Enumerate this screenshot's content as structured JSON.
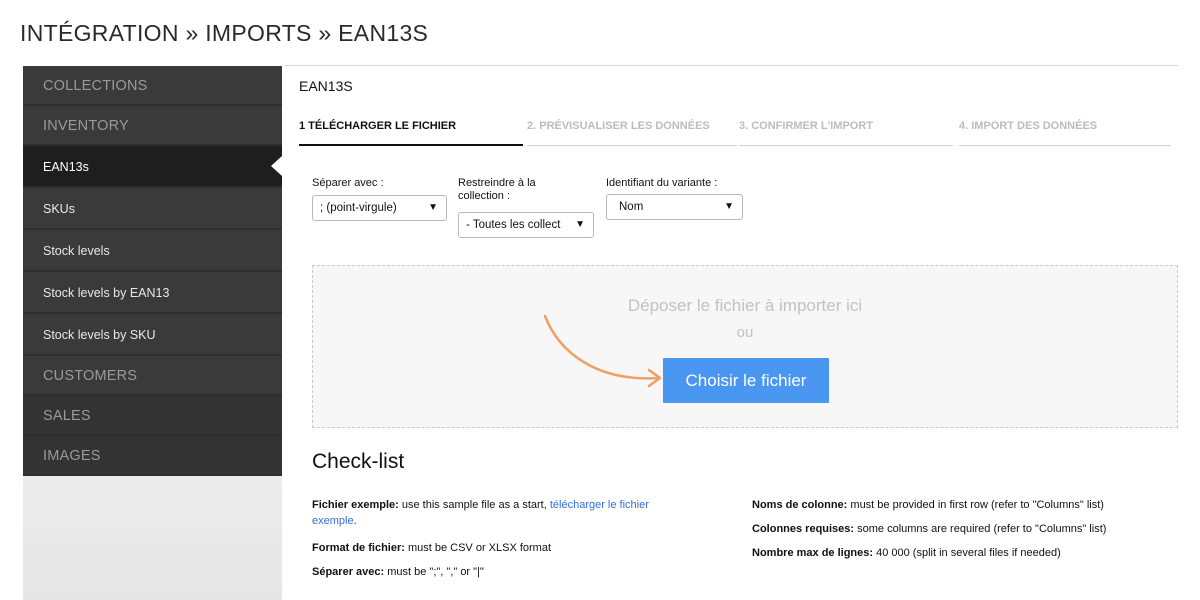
{
  "breadcrumb": "INTÉGRATION » IMPORTS » EAN13S",
  "sidebar": {
    "items": [
      {
        "label": "COLLECTIONS"
      },
      {
        "label": "INVENTORY"
      },
      {
        "label": "EAN13s"
      },
      {
        "label": "SKUs"
      },
      {
        "label": "Stock levels"
      },
      {
        "label": "Stock levels by EAN13"
      },
      {
        "label": "Stock levels by SKU"
      },
      {
        "label": "CUSTOMERS"
      },
      {
        "label": "SALES"
      },
      {
        "label": "IMAGES"
      }
    ],
    "active": "EAN13s"
  },
  "content": {
    "title": "EAN13S",
    "steps": [
      "1 TÉLÉCHARGER LE FICHIER",
      "2. PRÉVISUALISER LES DONNÉES",
      "3. CONFIRMER L'IMPORT",
      "4. IMPORT DES DONNÉES"
    ],
    "active_step": 0
  },
  "form": {
    "separator_label": "Séparer avec :",
    "separator_value": "; (point-virgule)",
    "collection_label_line1": "Restreindre à la",
    "collection_label_line2": "collection :",
    "collection_value": "- Toutes les collect",
    "variant_label": "Identifiant du variante :",
    "variant_value": "Nom"
  },
  "dropzone": {
    "text": "Déposer le fichier à importer ici",
    "or": "ou",
    "button": "Choisir le fichier",
    "arrow_color": "#f0a064"
  },
  "checklist": {
    "title": "Check-list",
    "items_left": {
      "sample_label": "Fichier exemple:",
      "sample_text": " use this sample file as a start, ",
      "sample_link_1": "télécharger le fichier",
      "sample_link_2": "exemple",
      "sample_end": ".",
      "format_label": "Format de fichier:",
      "format_text": " must be CSV or XLSX format",
      "sep_label": "Séparer avec:",
      "sep_text": " must be \";\", \",\" or \"|\""
    },
    "items_right": {
      "cols_label": "Noms de colonne:",
      "cols_text": " must be provided in first row (refer to \"Columns\" list)",
      "req_label": "Colonnes requises:",
      "req_text": " some columns are required (refer to \"Columns\" list)",
      "max_label": "Nombre max de lignes:",
      "max_text": " 40 000 (split in several files if needed)"
    }
  },
  "colors": {
    "accent": "#4a97f1",
    "sidebar_bg": "#3a3a3a",
    "sidebar_active": "#1e1e1e",
    "link": "#2f6fe0"
  }
}
